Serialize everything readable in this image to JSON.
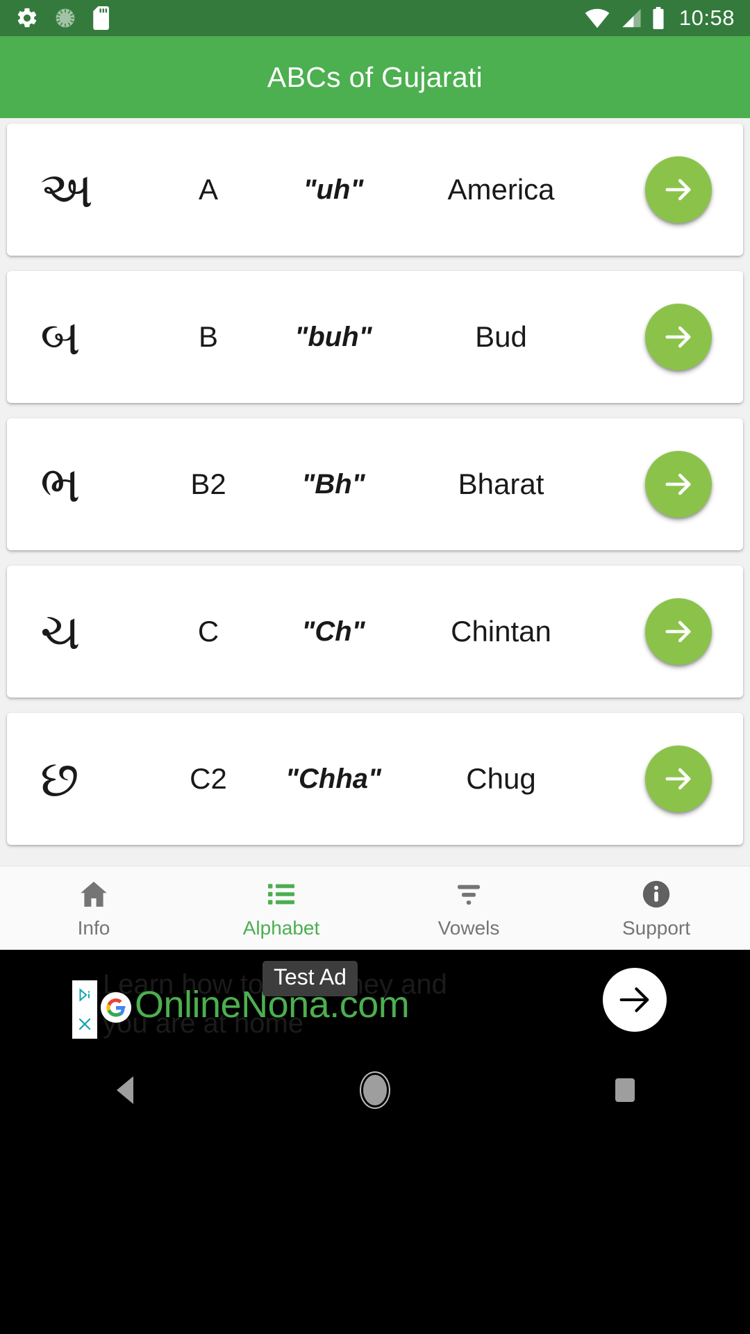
{
  "status_bar": {
    "icons_left": [
      "gear-icon",
      "sync-progress-icon",
      "sd-card-icon"
    ],
    "icons_right": [
      "wifi-icon",
      "cellular-signal-icon",
      "battery-icon"
    ],
    "time": "10:58",
    "background_color": "#347A3C"
  },
  "app_bar": {
    "title": "ABCs of Gujarati",
    "background_color": "#4CAF50",
    "title_color": "#FFFFFF"
  },
  "list": {
    "columns": [
      "letter",
      "english",
      "sound",
      "example",
      "go"
    ],
    "go_icon": "arrow-right-icon",
    "accent_color": "#8BC34A",
    "rows": [
      {
        "letter": "અ",
        "english": "A",
        "sound": "\"uh\"",
        "example": "America"
      },
      {
        "letter": "બ",
        "english": "B",
        "sound": "\"buh\"",
        "example": "Bud"
      },
      {
        "letter": "ભ",
        "english": "B2",
        "sound": "\"Bh\"",
        "example": "Bharat"
      },
      {
        "letter": "ચ",
        "english": "C",
        "sound": "\"Ch\"",
        "example": "Chintan"
      },
      {
        "letter": "છ",
        "english": "C2",
        "sound": "\"Chha\"",
        "example": "Chug"
      }
    ]
  },
  "bottom_nav": {
    "active_index": 1,
    "active_color": "#4CAF50",
    "inactive_color": "#757575",
    "items": [
      {
        "label": "Info",
        "icon": "home-icon"
      },
      {
        "label": "Alphabet",
        "icon": "list-icon"
      },
      {
        "label": "Vowels",
        "icon": "filter-icon"
      },
      {
        "label": "Support",
        "icon": "info-circle-icon"
      }
    ]
  },
  "ad_banner": {
    "badge": "Test Ad",
    "watermark": "OnlineNona.com",
    "body_text": "Learn how to do money and\nyou are at home",
    "adchoices_icon": "adchoices-icon",
    "close_icon": "close-icon",
    "google_icon": "google-logo-icon",
    "cta_icon": "arrow-right-icon",
    "background_color": "#000000"
  },
  "android_nav": {
    "items": [
      {
        "icon": "back-triangle-icon"
      },
      {
        "icon": "home-circle-icon"
      },
      {
        "icon": "recents-square-icon"
      }
    ]
  }
}
